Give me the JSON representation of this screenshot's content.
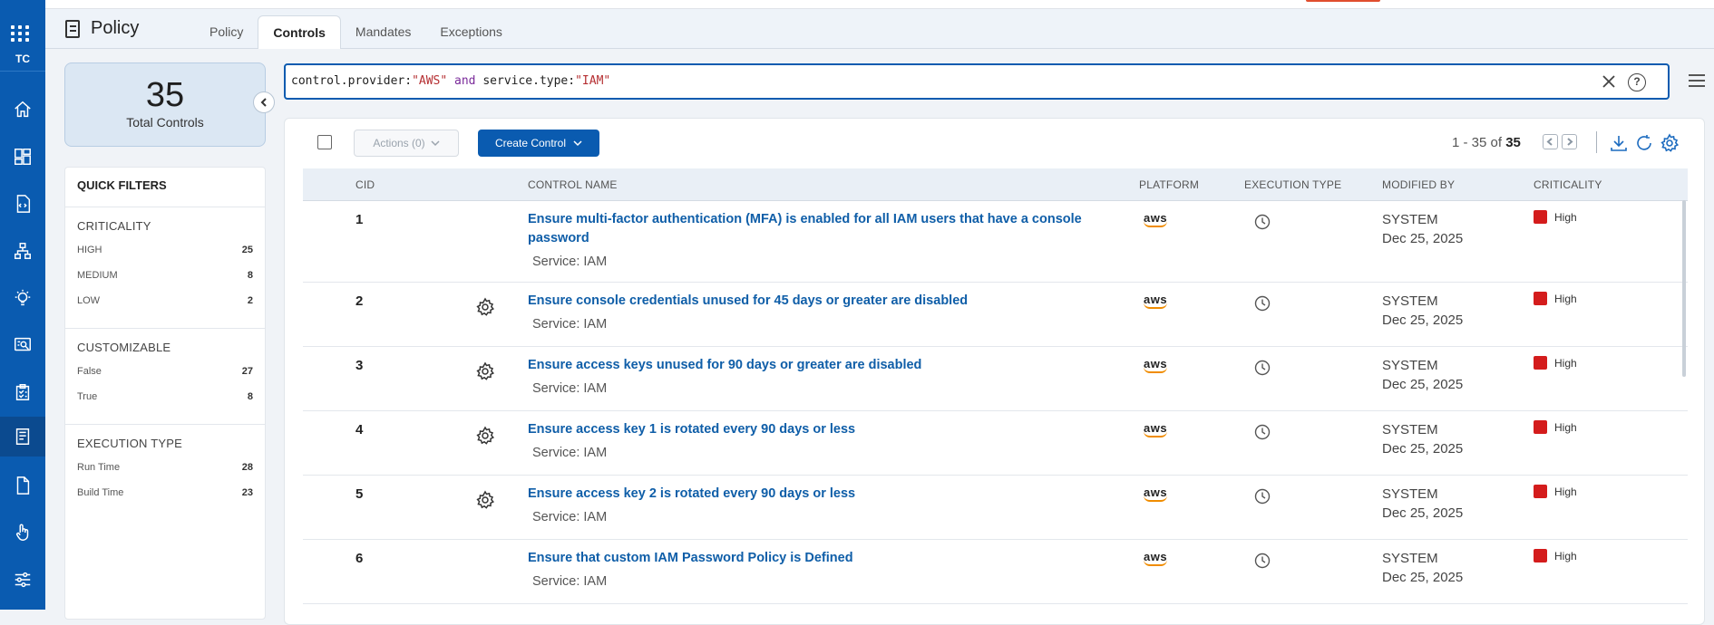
{
  "rail": {
    "org_label": "TC",
    "items": [
      {
        "name": "home-icon"
      },
      {
        "name": "dashboard-icon"
      },
      {
        "name": "code-icon"
      },
      {
        "name": "hierarchy-icon"
      },
      {
        "name": "insights-icon"
      },
      {
        "name": "search-report-icon"
      },
      {
        "name": "checklist-icon"
      },
      {
        "name": "policy-icon",
        "active": true
      },
      {
        "name": "document-icon"
      },
      {
        "name": "hand-pointer-icon"
      },
      {
        "name": "settings-sliders-icon"
      }
    ]
  },
  "header": {
    "title": "Policy",
    "tabs": [
      {
        "label": "Policy"
      },
      {
        "label": "Controls",
        "active": true
      },
      {
        "label": "Mandates"
      },
      {
        "label": "Exceptions"
      }
    ]
  },
  "summary": {
    "total": "35",
    "total_label": "Total Controls"
  },
  "filters": {
    "title": "QUICK FILTERS",
    "groups": [
      {
        "title": "CRITICALITY",
        "items": [
          {
            "label": "HIGH",
            "count": "25"
          },
          {
            "label": "MEDIUM",
            "count": "8"
          },
          {
            "label": "LOW",
            "count": "2"
          }
        ]
      },
      {
        "title": "CUSTOMIZABLE",
        "items": [
          {
            "label": "False",
            "count": "27"
          },
          {
            "label": "True",
            "count": "8"
          }
        ]
      },
      {
        "title": "EXECUTION TYPE",
        "items": [
          {
            "label": "Run Time",
            "count": "28"
          },
          {
            "label": "Build Time",
            "count": "23"
          }
        ]
      }
    ]
  },
  "search": {
    "query": "control.provider:\"AWS\" and service.type:\"IAM\""
  },
  "toolbar": {
    "actions_label": "Actions (0)",
    "create_label": "Create Control",
    "range_text": "1 - 35 of",
    "range_total": "35"
  },
  "table": {
    "columns": [
      "CID",
      "CONTROL NAME",
      "PLATFORM",
      "EXECUTION TYPE",
      "MODIFIED BY",
      "CRITICALITY"
    ],
    "rows": [
      {
        "cid": "1",
        "name": "Ensure multi-factor authentication (MFA) is enabled for all IAM users that have a console password",
        "service": "Service: IAM",
        "customizable": false,
        "platform": "aws",
        "modified_by": "SYSTEM",
        "modified_date": "Dec 25, 2025",
        "criticality": "High"
      },
      {
        "cid": "2",
        "name": "Ensure console credentials unused for 45 days or greater are disabled",
        "service": "Service: IAM",
        "customizable": true,
        "platform": "aws",
        "modified_by": "SYSTEM",
        "modified_date": "Dec 25, 2025",
        "criticality": "High"
      },
      {
        "cid": "3",
        "name": "Ensure access keys unused for 90 days or greater are disabled",
        "service": "Service: IAM",
        "customizable": true,
        "platform": "aws",
        "modified_by": "SYSTEM",
        "modified_date": "Dec 25, 2025",
        "criticality": "High"
      },
      {
        "cid": "4",
        "name": "Ensure access key 1 is rotated every 90 days or less",
        "service": "Service: IAM",
        "customizable": true,
        "platform": "aws",
        "modified_by": "SYSTEM",
        "modified_date": "Dec 25, 2025",
        "criticality": "High"
      },
      {
        "cid": "5",
        "name": "Ensure access key 2 is rotated every 90 days or less",
        "service": "Service: IAM",
        "customizable": true,
        "platform": "aws",
        "modified_by": "SYSTEM",
        "modified_date": "Dec 25, 2025",
        "criticality": "High"
      },
      {
        "cid": "6",
        "name": "Ensure that custom IAM Password Policy is Defined",
        "service": "Service: IAM",
        "customizable": false,
        "platform": "aws",
        "modified_by": "SYSTEM",
        "modified_date": "Dec 25, 2025",
        "criticality": "High"
      }
    ]
  },
  "colors": {
    "brand": "#0a5bb0",
    "link": "#0f5ea8",
    "high": "#d41c1c",
    "aws_smile": "#f08c00"
  }
}
